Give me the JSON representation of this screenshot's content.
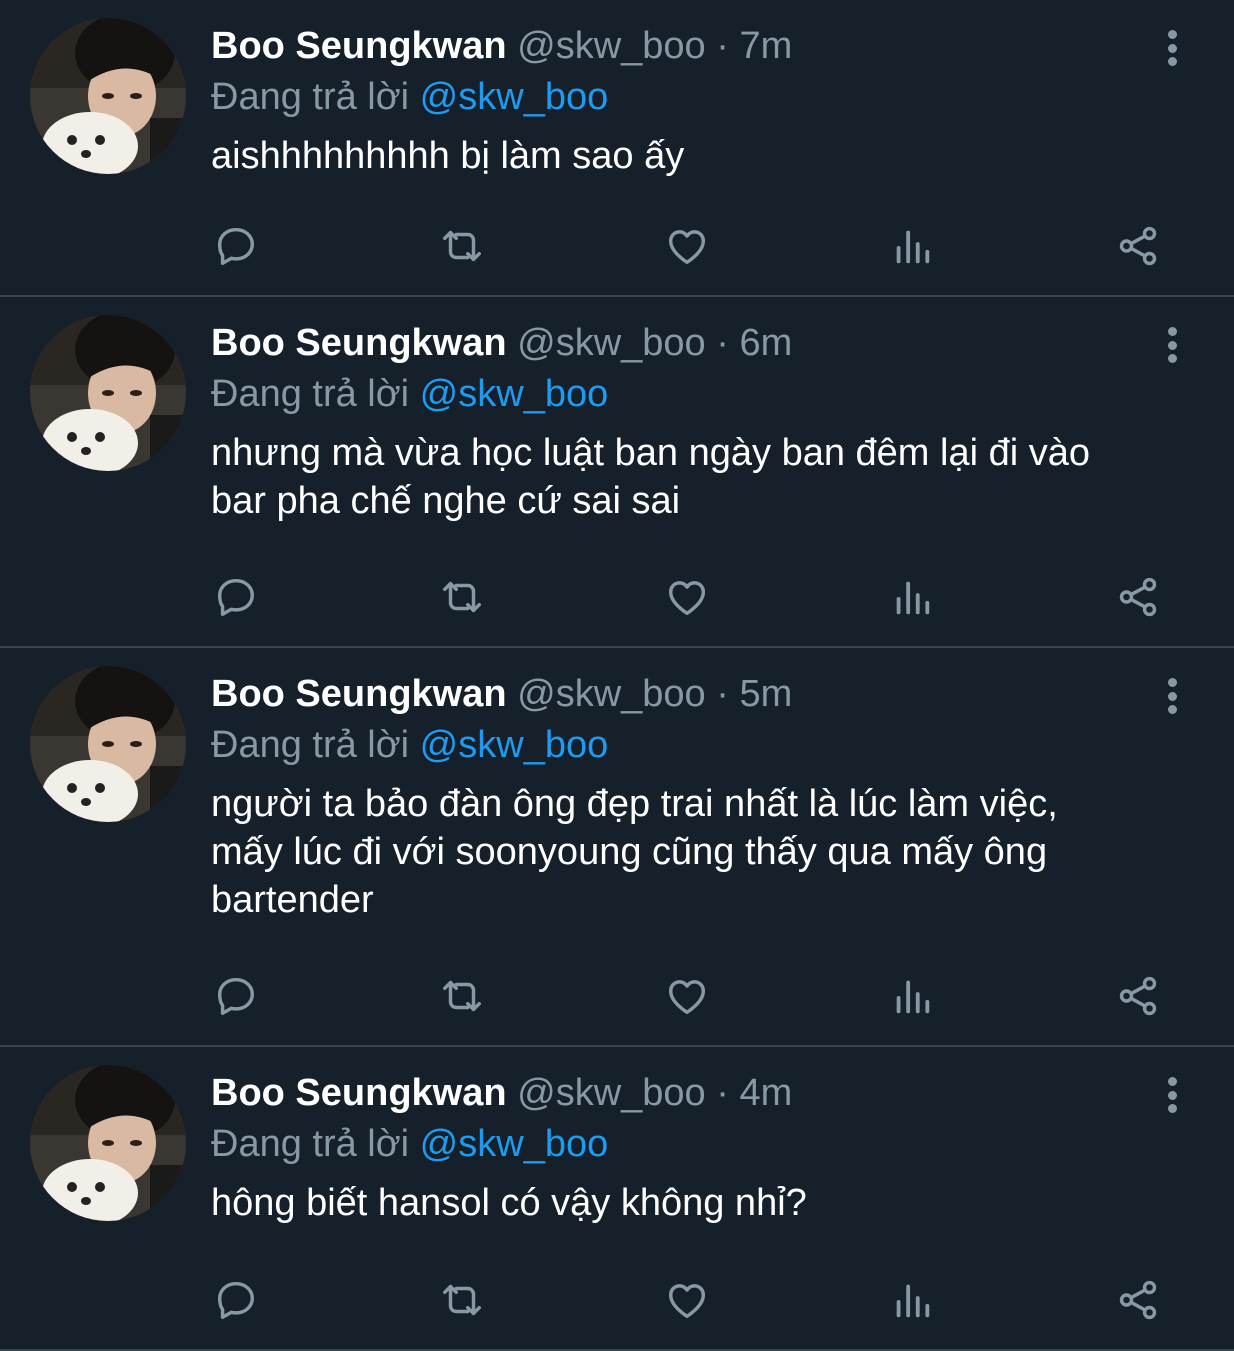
{
  "colors": {
    "background": "#15202b",
    "muted": "#8899a6",
    "link": "#1d9bf0",
    "divider": "#38444d"
  },
  "icons": [
    "reply-icon",
    "retweet-icon",
    "like-icon",
    "analytics-icon",
    "share-icon",
    "more-icon"
  ],
  "tweets": [
    {
      "name": "Boo Seungkwan",
      "handle": "@skw_boo",
      "dot": "·",
      "time": "7m",
      "reply_prefix": "Đang trả lời",
      "reply_to": "@skw_boo",
      "text": "aishhhhhhhhh bị làm sao ấy"
    },
    {
      "name": "Boo Seungkwan",
      "handle": "@skw_boo",
      "dot": "·",
      "time": "6m",
      "reply_prefix": "Đang trả lời",
      "reply_to": "@skw_boo",
      "text": "nhưng mà vừa học luật ban ngày ban đêm lại đi vào\nbar pha chế nghe cứ sai sai"
    },
    {
      "name": "Boo Seungkwan",
      "handle": "@skw_boo",
      "dot": "·",
      "time": "5m",
      "reply_prefix": "Đang trả lời",
      "reply_to": "@skw_boo",
      "text": "người ta bảo đàn ông đẹp trai nhất là lúc làm việc,\nmấy lúc đi với soonyoung cũng thấy qua mấy ông\nbartender"
    },
    {
      "name": "Boo Seungkwan",
      "handle": "@skw_boo",
      "dot": "·",
      "time": "4m",
      "reply_prefix": "Đang trả lời",
      "reply_to": "@skw_boo",
      "text": "hông biết hansol có vậy không nhỉ?"
    }
  ]
}
